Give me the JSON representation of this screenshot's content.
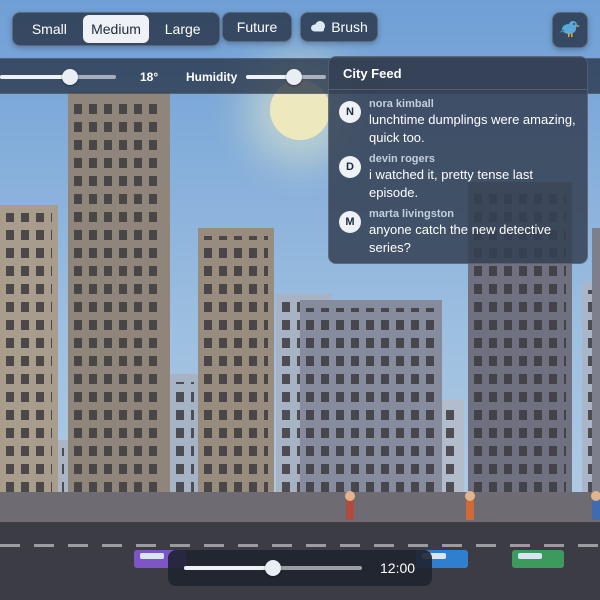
{
  "toolbar": {
    "sizes": [
      {
        "label": "Small",
        "active": false
      },
      {
        "label": "Medium",
        "active": true
      },
      {
        "label": "Large",
        "active": false
      }
    ],
    "future_label": "Future",
    "brush_label": "Brush",
    "brush_icon": "cloud-icon",
    "bird_icon": "bird-icon"
  },
  "controls": {
    "temperature": {
      "value_label": "18°",
      "level": 0.6
    },
    "humidity": {
      "label": "Humidity",
      "level": 0.6
    }
  },
  "feed": {
    "title": "City Feed",
    "items": [
      {
        "initial": "N",
        "author": "nora kimball",
        "message": "lunchtime dumplings were amazing, quick too."
      },
      {
        "initial": "D",
        "author": "devin rogers",
        "message": "i watched it, pretty tense last episode."
      },
      {
        "initial": "M",
        "author": "marta livingston",
        "message": "anyone catch the new detective series?"
      }
    ]
  },
  "time": {
    "label": "12:00",
    "level": 0.5
  },
  "colors": {
    "panel": "#283448",
    "accent": "#eef2f7"
  }
}
